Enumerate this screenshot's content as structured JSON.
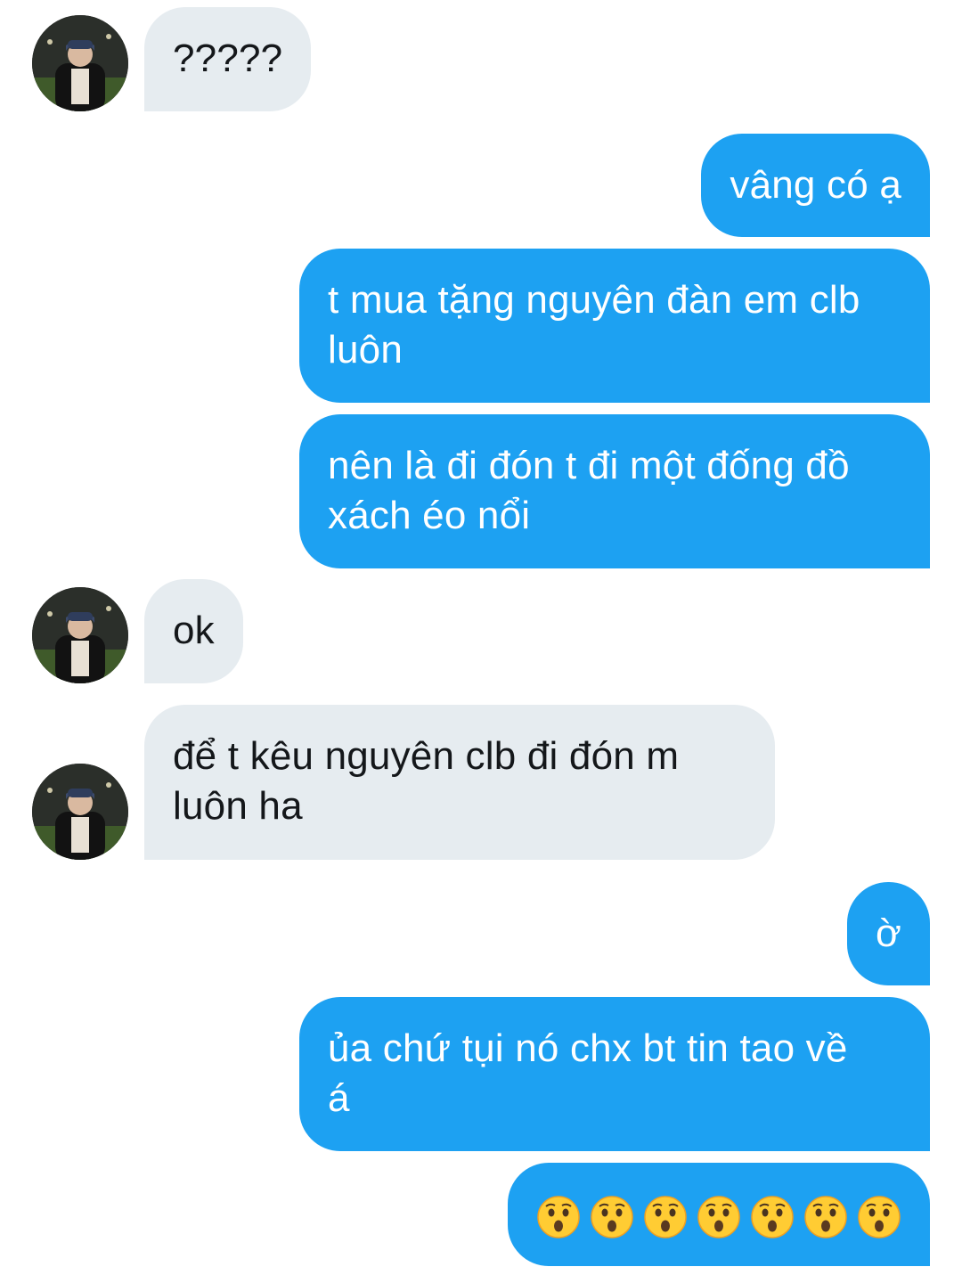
{
  "conversation": {
    "messages": [
      {
        "sender": "other",
        "lines": [
          "?????"
        ]
      },
      {
        "sender": "me",
        "lines": [
          "vâng có ạ"
        ]
      },
      {
        "sender": "me",
        "lines": [
          "t mua tặng nguyên đàn em clb",
          "luôn"
        ]
      },
      {
        "sender": "me",
        "lines": [
          "nên là đi đón t đi một đống đồ",
          "xách éo nổi"
        ]
      },
      {
        "sender": "other",
        "lines": [
          "ok"
        ]
      },
      {
        "sender": "other",
        "lines": [
          "để t kêu nguyên clb đi đón m",
          "luôn ha"
        ]
      },
      {
        "sender": "me",
        "lines": [
          "ờ"
        ]
      },
      {
        "sender": "me",
        "lines": [
          "ủa chứ tụi nó chx bt tin tao về",
          "á"
        ]
      },
      {
        "sender": "me",
        "emoji": [
          "hushed-face",
          "hushed-face",
          "hushed-face",
          "hushed-face",
          "hushed-face",
          "hushed-face",
          "hushed-face"
        ]
      }
    ]
  },
  "colors": {
    "incoming_bubble": "#e6ecf0",
    "outgoing_bubble": "#1da1f2",
    "incoming_text": "#14171a",
    "outgoing_text": "#ffffff"
  }
}
